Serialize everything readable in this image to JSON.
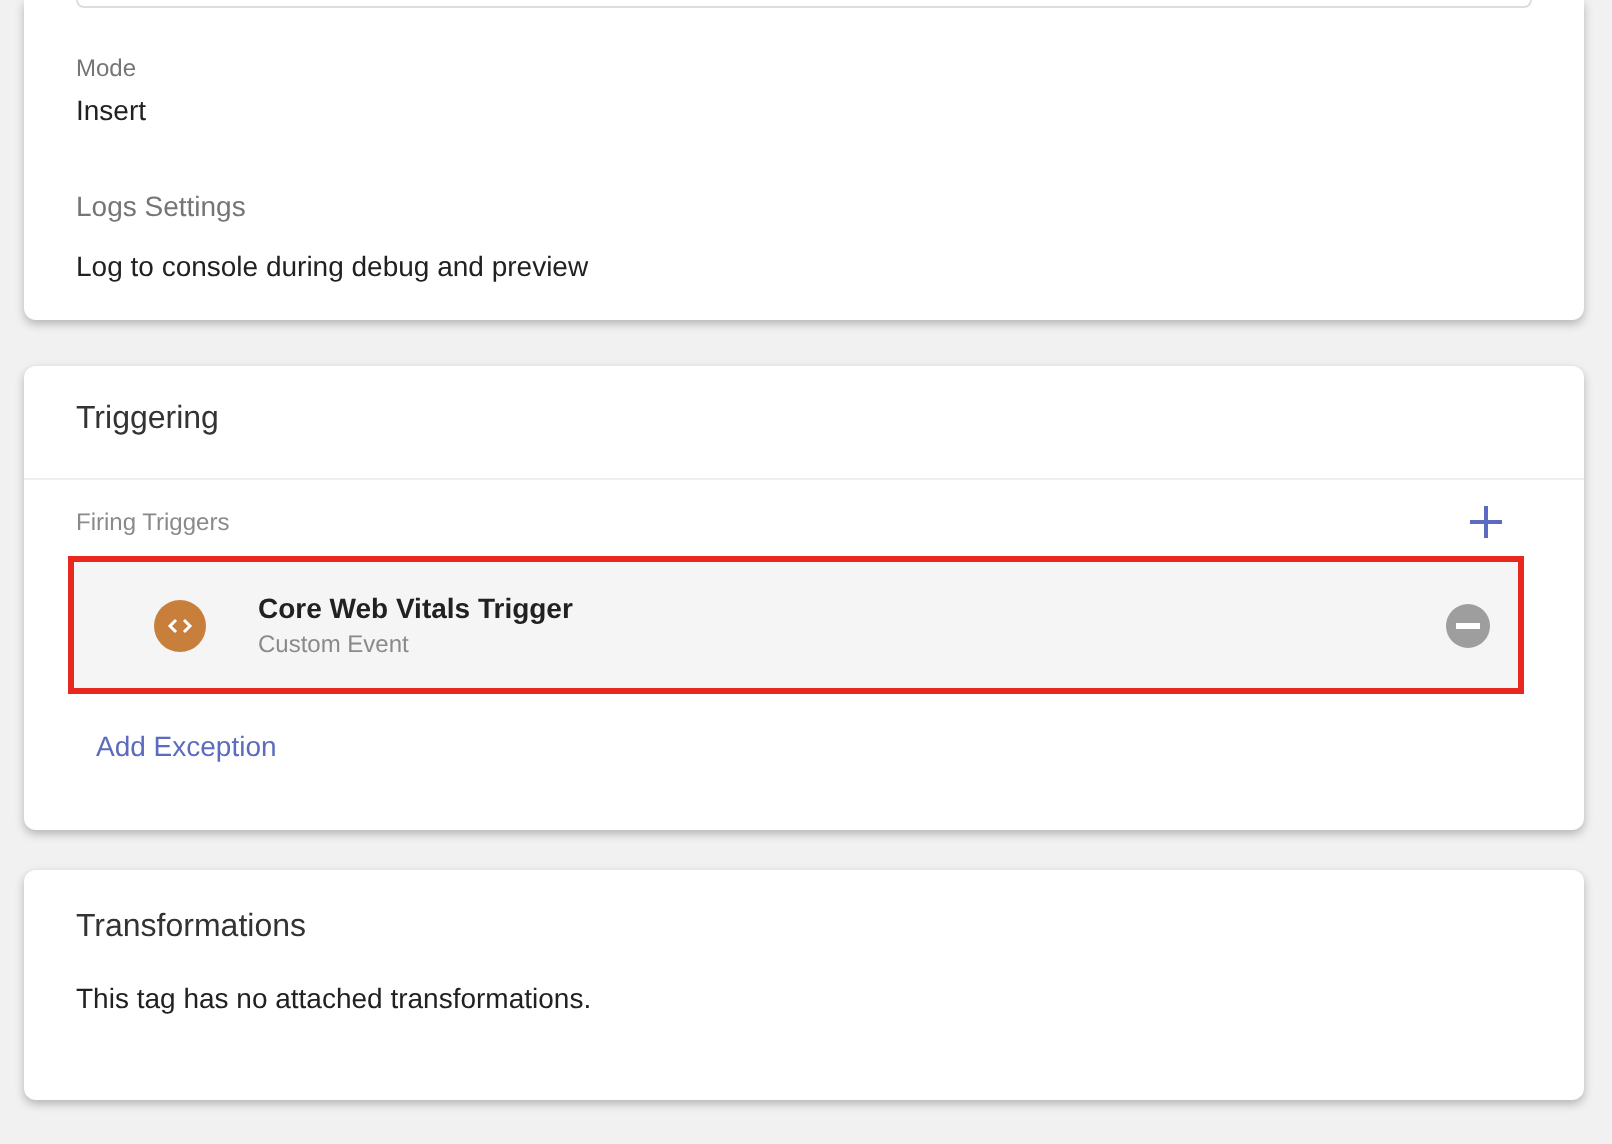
{
  "configuration": {
    "fields": [
      {
        "label": "Mode",
        "value": "Insert"
      },
      {
        "label": "Logs Settings",
        "value": "Log to console during debug and preview"
      }
    ]
  },
  "triggering": {
    "title": "Triggering",
    "firing_label": "Firing Triggers",
    "triggers": [
      {
        "name": "Core Web Vitals Trigger",
        "type": "Custom Event",
        "color": "#c97f3c",
        "highlighted": true
      }
    ],
    "add_exception": "Add Exception"
  },
  "transformations": {
    "title": "Transformations",
    "message": "This tag has no attached transformations."
  }
}
